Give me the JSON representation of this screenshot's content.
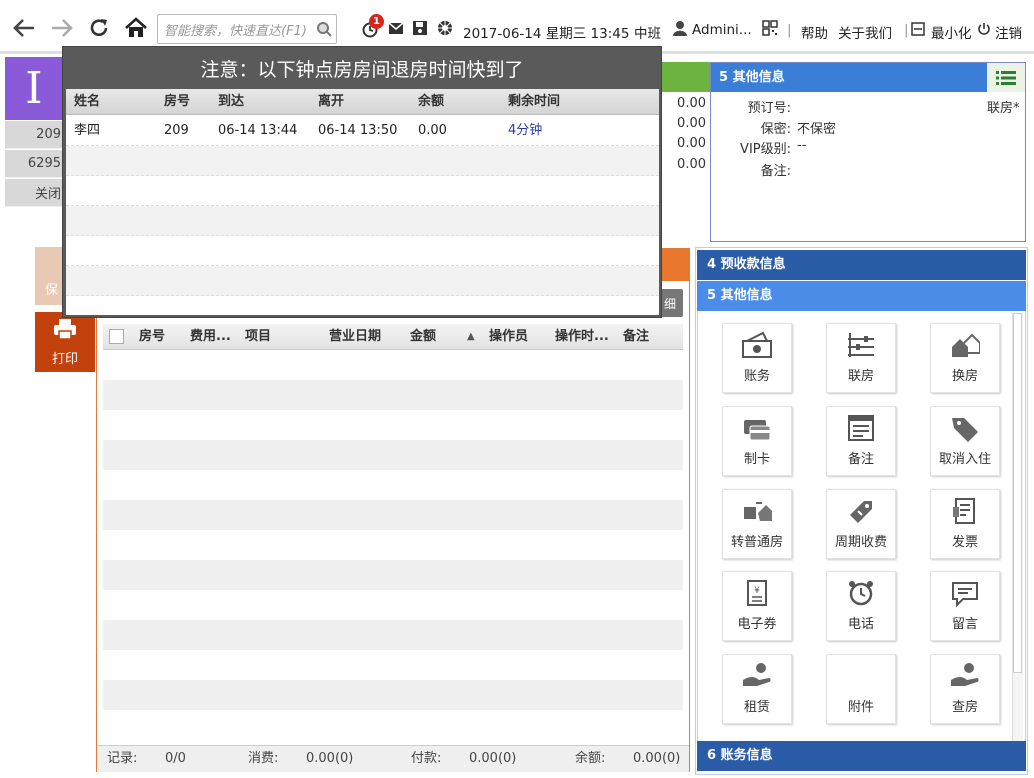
{
  "toolbar": {
    "search_placeholder": "智能搜索，快速直达(F1)",
    "notify_count": "1",
    "datetime": "2017-06-14 星期三 13:45",
    "shift": "中班",
    "user": "Admini...",
    "help": "帮助",
    "about": "关于我们",
    "minimize": "最小化",
    "logout": "注销"
  },
  "left": {
    "room_letter": "I",
    "row1": "209",
    "row2": "6295",
    "row3": "关闭",
    "save_label": "保",
    "print_label": "打印"
  },
  "popup": {
    "title": "注意：以下钟点房房间退房时间快到了",
    "columns": [
      "姓名",
      "房号",
      "到达",
      "离开",
      "余额",
      "剩余时间"
    ],
    "rows": [
      {
        "name": "李四",
        "room": "209",
        "arrive": "06-14 13:44",
        "leave": "06-14 13:50",
        "balance": "0.00",
        "remaining": "4分钟"
      }
    ]
  },
  "money": [
    "0.00",
    "0.00",
    "0.00",
    "0.00"
  ],
  "other_info": {
    "header": "5 其他信息",
    "booking_no_label": "预订号:",
    "booking_no": "",
    "linked": "联房*",
    "secret_label": "保密:",
    "secret": "不保密",
    "vip_label": "VIP级别:",
    "vip": "--",
    "remark_label": "备注:",
    "remark": ""
  },
  "main": {
    "detail_btn": "细",
    "columns": [
      "房号",
      "费用...",
      "项目",
      "营业日期",
      "金额",
      "操作员",
      "操作时...",
      "备注"
    ],
    "footer": {
      "records_label": "记录:",
      "records": "0/0",
      "consume_label": "消费:",
      "consume": "0.00(0)",
      "pay_label": "付款:",
      "pay": "0.00(0)",
      "balance_label": "余额:",
      "balance": "0.00(0)"
    }
  },
  "right": {
    "panel4": "4 预收款信息",
    "panel5": "5 其他信息",
    "panel6": "6 账务信息",
    "tiles": [
      "账务",
      "联房",
      "换房",
      "制卡",
      "备注",
      "取消入住",
      "转普通房",
      "周期收费",
      "发票",
      "电子券",
      "电话",
      "留言",
      "租赁",
      "附件",
      "查房"
    ]
  },
  "colors": {
    "accent_blue": "#3b7ed8",
    "dark_blue": "#2a5ca8",
    "orange": "#e8762d",
    "purple": "#8a5ad9",
    "print_orange": "#c2410c"
  }
}
